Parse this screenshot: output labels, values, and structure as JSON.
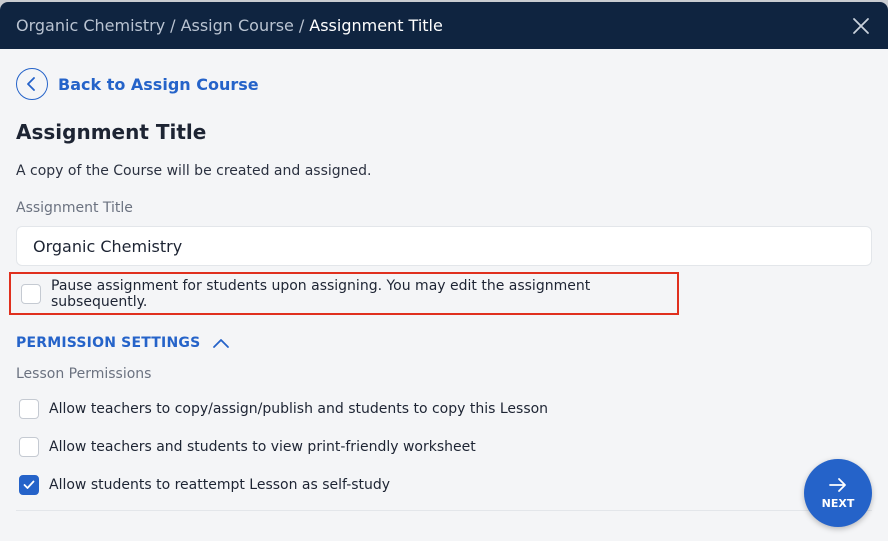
{
  "breadcrumb": {
    "items": [
      "Organic Chemistry",
      "Assign Course",
      "Assignment Title"
    ],
    "separator": "/"
  },
  "header": {
    "close_icon": "close-icon"
  },
  "back": {
    "label": "Back to Assign Course",
    "icon": "chevron-left-icon"
  },
  "page": {
    "title": "Assignment Title",
    "description": "A copy of the Course will be created and assigned."
  },
  "form": {
    "title_label": "Assignment Title",
    "title_value": "Organic Chemistry",
    "pause_label": "Pause assignment for students upon assigning. You may edit the assignment subsequently.",
    "pause_checked": false
  },
  "permissions": {
    "section_title": "PERMISSION SETTINGS",
    "expanded": true,
    "lesson_label": "Lesson Permissions",
    "items": [
      {
        "label": "Allow teachers to copy/assign/publish and students to copy this Lesson",
        "checked": false
      },
      {
        "label": "Allow teachers and students to view print-friendly worksheet",
        "checked": false
      },
      {
        "label": "Allow students to reattempt Lesson as self-study",
        "checked": true
      }
    ]
  },
  "next_button": {
    "label": "NEXT",
    "icon": "arrow-right-icon"
  },
  "colors": {
    "header_bg": "#0f2440",
    "accent": "#2563c9",
    "highlight_border": "#e0301e",
    "page_bg": "#f4f5f7"
  }
}
